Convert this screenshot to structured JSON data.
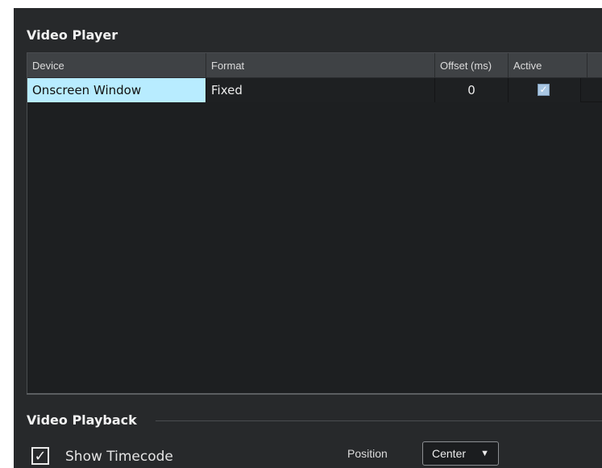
{
  "video_player": {
    "title": "Video Player",
    "columns": [
      "Device",
      "Format",
      "Offset (ms)",
      "Active"
    ],
    "rows": [
      {
        "device": "Onscreen Window",
        "format": "Fixed",
        "offset": "0",
        "active_mark": "✓"
      }
    ]
  },
  "video_playback": {
    "title": "Video Playback",
    "show_timecode_label": "Show Timecode",
    "show_timecode_mark": "✓",
    "position_label": "Position",
    "position_value": "Center",
    "dropdown_arrow": "▼"
  },
  "colors": {
    "panel_bg": "#27292b",
    "selected_cell": "#b8ecff",
    "table_header": "#3f4245"
  }
}
